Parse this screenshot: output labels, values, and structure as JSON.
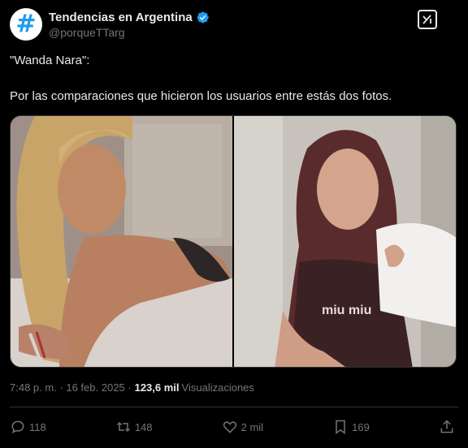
{
  "account": {
    "display_name": "Tendencias en Argentina",
    "handle": "@porqueTTarg",
    "avatar_glyph": "#",
    "verified": true,
    "brand_color": "#1d9bf0"
  },
  "post": {
    "line1": "\"Wanda Nara\":",
    "line2": "Por las comparaciones que hicieron los usuarios entre estás dos fotos.",
    "time": "7:48 p. m. · 16 feb. 2025 ·",
    "views_count": "123,6 mil",
    "views_label": "Visualizaciones"
  },
  "media": {
    "photo_left_text": "",
    "photo_right_shirt_text": "miu miu"
  },
  "actions": {
    "replies": "118",
    "reposts": "148",
    "likes": "2 mil",
    "bookmarks": "169"
  },
  "icons": {
    "grok": "grok-icon",
    "verified": "verified-badge-icon",
    "reply": "reply-icon",
    "repost": "repost-icon",
    "like": "heart-icon",
    "bookmark": "bookmark-icon",
    "share": "share-icon"
  }
}
